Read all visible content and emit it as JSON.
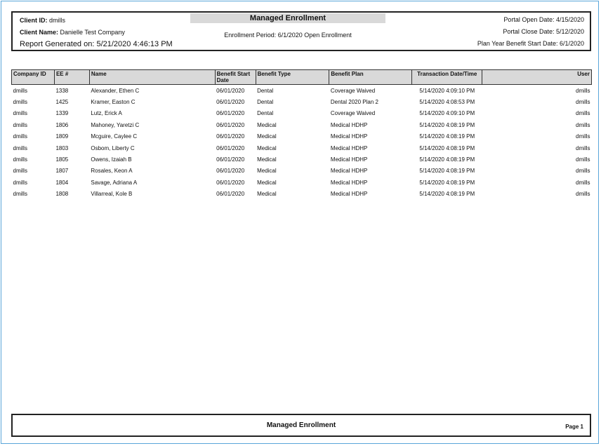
{
  "header": {
    "client_id_label": "Client ID:",
    "client_id_value": "dmills",
    "client_name_label": "Client Name:",
    "client_name_value": "Danielle Test Company",
    "report_generated": "Report Generated on: 5/21/2020 4:46:13 PM",
    "title": "Managed Enrollment",
    "enrollment_period": "Enrollment Period: 6/1/2020 Open Enrollment",
    "portal_open": "Portal Open Date: 4/15/2020",
    "portal_close": "Portal Close Date: 5/12/2020",
    "plan_year_start": "Plan Year Benefit Start Date: 6/1/2020"
  },
  "table": {
    "columns": [
      "Company ID",
      "EE #",
      "Name",
      "Benefit Start Date",
      "Benefit Type",
      "Benefit Plan",
      "Transaction Date/Time",
      "User"
    ],
    "rows": [
      [
        "dmills",
        "1338",
        "Alexander, Ethen C",
        "06/01/2020",
        "Dental",
        "Coverage Waived",
        "5/14/2020 4:09:10 PM",
        "dmills"
      ],
      [
        "dmills",
        "1425",
        "Kramer, Easton C",
        "06/01/2020",
        "Dental",
        "Dental 2020 Plan 2",
        "5/14/2020 4:08:53 PM",
        "dmills"
      ],
      [
        "dmills",
        "1339",
        "Lutz, Erick A",
        "06/01/2020",
        "Dental",
        "Coverage Waived",
        "5/14/2020 4:09:10 PM",
        "dmills"
      ],
      [
        "dmills",
        "1806",
        "Mahoney, Yaretzi C",
        "06/01/2020",
        "Medical",
        "Medical HDHP",
        "5/14/2020 4:08:19 PM",
        "dmills"
      ],
      [
        "dmills",
        "1809",
        "Mcguire, Caylee C",
        "06/01/2020",
        "Medical",
        "Medical HDHP",
        "5/14/2020 4:08:19 PM",
        "dmills"
      ],
      [
        "dmills",
        "1803",
        "Osbom, Liberty C",
        "06/01/2020",
        "Medical",
        "Medical HDHP",
        "5/14/2020 4:08:19 PM",
        "dmills"
      ],
      [
        "dmills",
        "1805",
        "Owens, Izaiah B",
        "06/01/2020",
        "Medical",
        "Medical HDHP",
        "5/14/2020 4:08:19 PM",
        "dmills"
      ],
      [
        "dmills",
        "1807",
        "Rosales, Keon A",
        "06/01/2020",
        "Medical",
        "Medical HDHP",
        "5/14/2020 4:08:19 PM",
        "dmills"
      ],
      [
        "dmills",
        "1804",
        "Savage, Adriana A",
        "06/01/2020",
        "Medical",
        "Medical HDHP",
        "5/14/2020 4:08:19 PM",
        "dmills"
      ],
      [
        "dmills",
        "1808",
        "Villarreal, Kole B",
        "06/01/2020",
        "Medical",
        "Medical HDHP",
        "5/14/2020 4:08:19 PM",
        "dmills"
      ]
    ]
  },
  "footer": {
    "title": "Managed Enrollment",
    "page": "Page 1"
  }
}
